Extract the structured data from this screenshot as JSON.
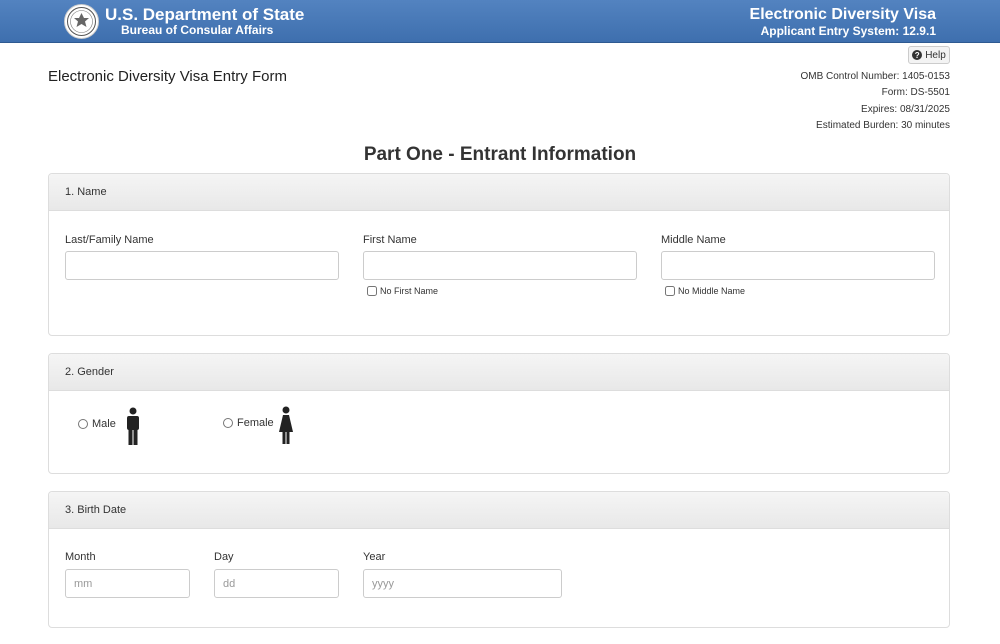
{
  "header": {
    "department": "U.S. Department of State",
    "bureau": "Bureau of Consular Affairs",
    "system_title": "Electronic Diversity Visa",
    "system_version": "Applicant Entry System: 12.9.1",
    "brand_color": "#4a7bbb"
  },
  "help": {
    "label": "Help"
  },
  "form": {
    "title": "Electronic Diversity Visa Entry Form",
    "omb": "OMB Control Number: 1405-0153",
    "form_number": "Form: DS-5501",
    "expires": "Expires: 08/31/2025",
    "burden": "Estimated Burden: 30 minutes"
  },
  "part_heading": "Part One - Entrant Information",
  "name_section": {
    "title": "1. Name",
    "last_label": "Last/Family Name",
    "first_label": "First Name",
    "middle_label": "Middle Name",
    "last_value": "",
    "first_value": "",
    "middle_value": "",
    "no_first_label": "No First Name",
    "no_middle_label": "No Middle Name"
  },
  "gender_section": {
    "title": "2. Gender",
    "male_label": "Male",
    "female_label": "Female",
    "male_icon": "male-figure-icon",
    "female_icon": "female-figure-icon"
  },
  "birth_section": {
    "title": "3. Birth Date",
    "month_label": "Month",
    "day_label": "Day",
    "year_label": "Year",
    "month_placeholder": "mm",
    "day_placeholder": "dd",
    "year_placeholder": "yyyy"
  }
}
